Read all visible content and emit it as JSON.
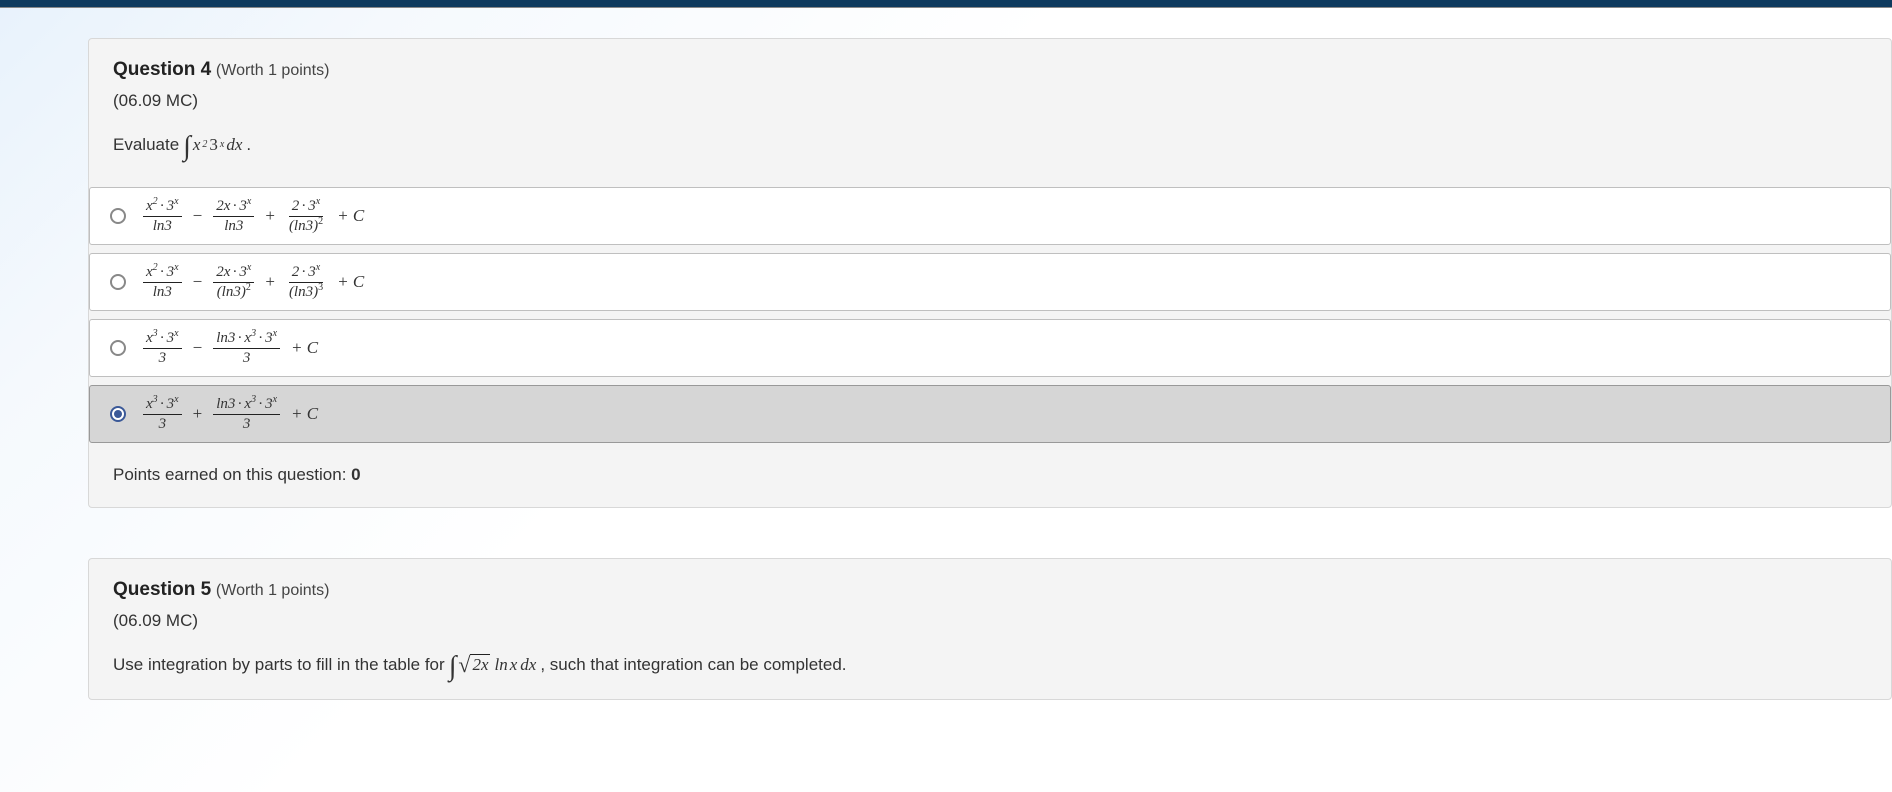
{
  "q4": {
    "title": "Question 4",
    "worth": "(Worth 1 points)",
    "code": "(06.09 MC)",
    "prompt_prefix": "Evaluate",
    "prompt_suffix": ".",
    "integral_expr": {
      "integrand": "x²3ˣ",
      "dvar": "dx"
    },
    "options": [
      {
        "selected": false,
        "terms": [
          {
            "num": "x²·3ˣ",
            "den": "ln3"
          },
          {
            "op": "−"
          },
          {
            "num": "2x·3ˣ",
            "den": "ln3"
          },
          {
            "op": "+"
          },
          {
            "num": "2·3ˣ",
            "den": "(ln3)²"
          }
        ],
        "tail": "+ C"
      },
      {
        "selected": false,
        "terms": [
          {
            "num": "x²·3ˣ",
            "den": "ln3"
          },
          {
            "op": "−"
          },
          {
            "num": "2x·3ˣ",
            "den": "(ln3)²"
          },
          {
            "op": "+"
          },
          {
            "num": "2·3ˣ",
            "den": "(ln3)³"
          }
        ],
        "tail": "+ C"
      },
      {
        "selected": false,
        "terms": [
          {
            "num": "x³·3ˣ",
            "den": "3"
          },
          {
            "op": "−"
          },
          {
            "num": "ln3·x³·3ˣ",
            "den": "3"
          }
        ],
        "tail": "+ C"
      },
      {
        "selected": true,
        "terms": [
          {
            "num": "x³·3ˣ",
            "den": "3"
          },
          {
            "op": "+"
          },
          {
            "num": "ln3·x³·3ˣ",
            "den": "3"
          }
        ],
        "tail": "+ C"
      }
    ],
    "points_label": "Points earned on this question:",
    "points_value": "0"
  },
  "q5": {
    "title": "Question 5",
    "worth": "(Worth 1 points)",
    "code": "(06.09 MC)",
    "prompt_prefix": "Use integration by parts to fill in the table for",
    "integral_expr": {
      "radicand": "2x",
      "rest": "ln x",
      "dvar": "dx"
    },
    "prompt_suffix": ", such that integration can be completed."
  }
}
